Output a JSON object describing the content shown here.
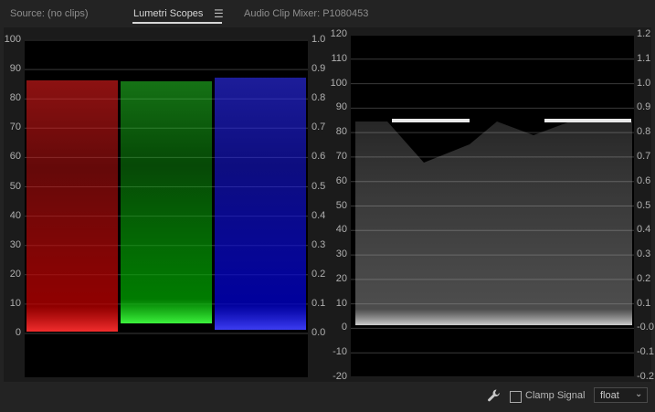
{
  "tabs": {
    "source": "Source: (no clips)",
    "lumetri": "Lumetri Scopes",
    "audio_mixer": "Audio Clip Mixer: P1080453"
  },
  "icons": {
    "menu": "hamburger-menu-icon",
    "wrench": "wrench-icon",
    "dropdown": "chevron-down-icon"
  },
  "parade": {
    "left_axis": [
      "100",
      "90",
      "80",
      "70",
      "60",
      "50",
      "40",
      "30",
      "20",
      "10",
      "0"
    ],
    "right_axis": [
      "1.0",
      "0.9",
      "0.8",
      "0.7",
      "0.6",
      "0.5",
      "0.4",
      "0.3",
      "0.2",
      "0.1",
      "0.0"
    ],
    "channel_colors": [
      "#e01414",
      "#10d010",
      "#1a1aff"
    ]
  },
  "waveform": {
    "left_axis": [
      "120",
      "110",
      "100",
      "90",
      "80",
      "70",
      "60",
      "50",
      "40",
      "30",
      "20",
      "10",
      "0",
      "-10",
      "-20"
    ],
    "right_axis": [
      "1.2",
      "1.1",
      "1.0",
      "0.9",
      "0.8",
      "0.7",
      "0.6",
      "0.5",
      "0.4",
      "0.3",
      "0.2",
      "0.1",
      "-0.0",
      "-0.1",
      "-0.2"
    ]
  },
  "controls": {
    "clamp_label": "Clamp Signal",
    "clamp_checked": false,
    "precision_value": "float"
  },
  "colors": {
    "background": "#232323",
    "scope_bg": "#000000",
    "panel_bg": "#1b1b1b"
  }
}
